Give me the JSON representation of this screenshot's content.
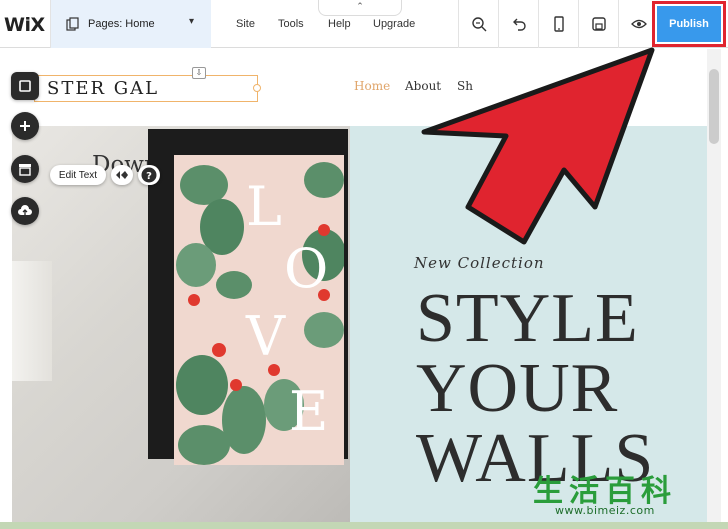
{
  "app": {
    "logo": "WiX"
  },
  "pages_dropdown": {
    "label": "Pages: Home"
  },
  "menu": [
    {
      "label": "Site"
    },
    {
      "label": "Tools"
    },
    {
      "label": "Help"
    },
    {
      "label": "Upgrade"
    }
  ],
  "tools": [
    {
      "icon": "zoom-icon"
    },
    {
      "icon": "undo-icon"
    },
    {
      "icon": "mobile-icon"
    },
    {
      "icon": "save-icon"
    },
    {
      "icon": "preview-icon"
    }
  ],
  "publish": {
    "label": "Publish",
    "color": "#3899ec",
    "highlight": "#e0242f"
  },
  "site": {
    "title": "STER GAL",
    "nav": [
      {
        "label": "Home",
        "active": true
      },
      {
        "label": "About"
      },
      {
        "label": "Sh"
      }
    ]
  },
  "left_toolbar": [
    {
      "icon": "background-icon"
    },
    {
      "icon": "add-icon"
    },
    {
      "icon": "store-icon"
    },
    {
      "icon": "upload-icon"
    }
  ],
  "context": {
    "edit_text": "Edit Text"
  },
  "hero": {
    "download": "Download Here",
    "poster_letters": [
      "L",
      "O",
      "V",
      "E"
    ],
    "collection": "New Collection",
    "headline": [
      "STYLE",
      "YOUR",
      "WALLS"
    ]
  },
  "watermark": {
    "cjk": "生活百科",
    "url": "www.bimeiz.com"
  },
  "colors": {
    "accent_nav": "#e0a56a",
    "hero_panel": "#d5e8e9",
    "arrow": "#e0242f",
    "frame_bg": "#c3d7b5"
  }
}
